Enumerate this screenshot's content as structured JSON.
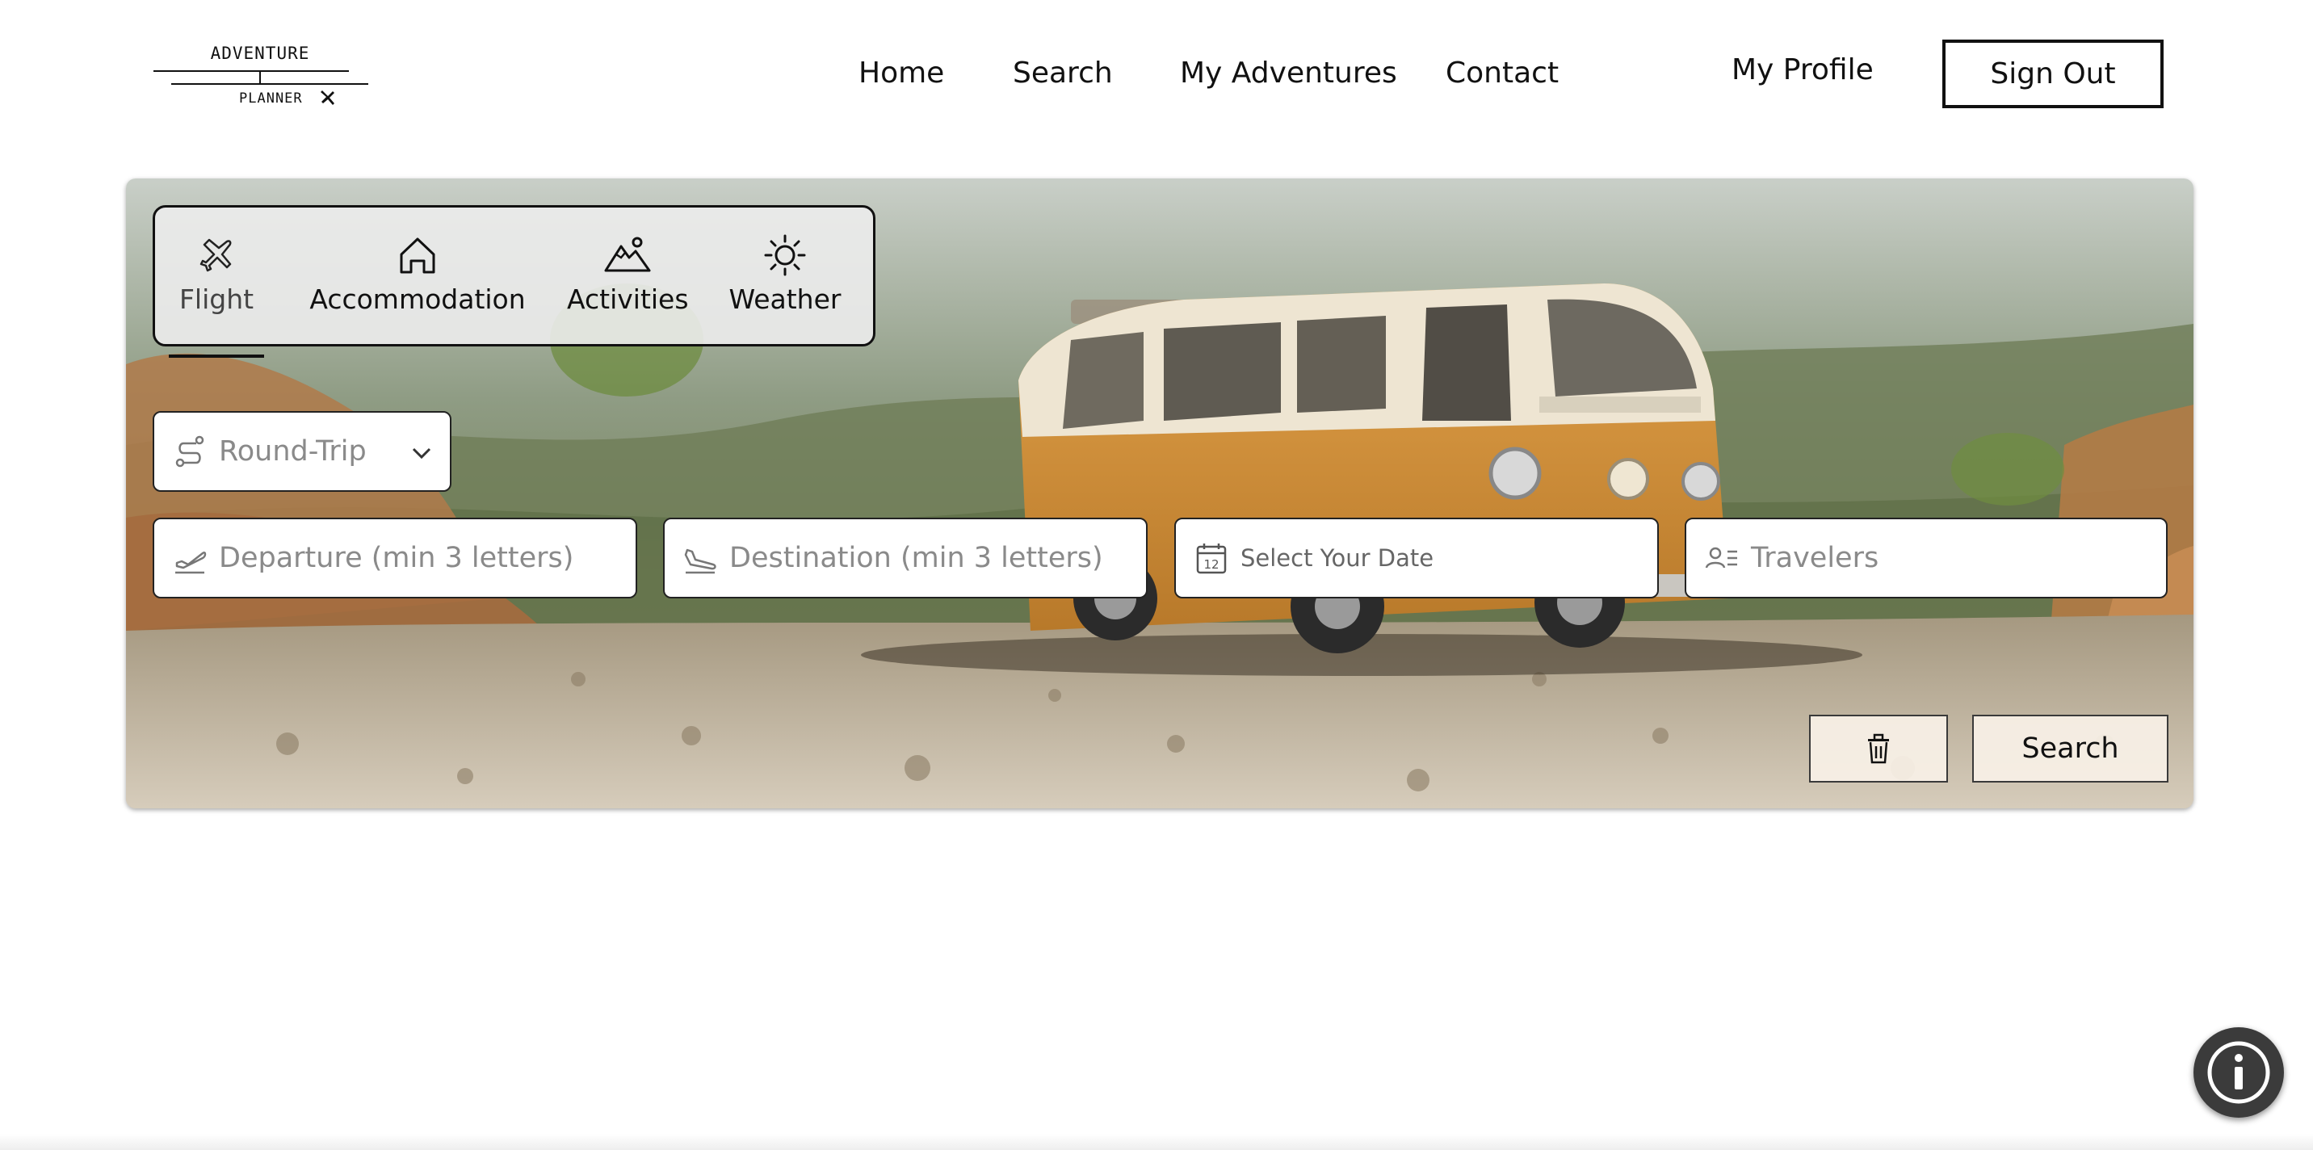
{
  "header": {
    "logo": {
      "line1": "ADVENTURE",
      "line2": "PLANNER",
      "icon": "airplane-icon"
    },
    "nav": [
      {
        "label": "Home"
      },
      {
        "label": "Search"
      },
      {
        "label": "My Adventures"
      },
      {
        "label": "Contact"
      }
    ],
    "profile_label": "My Profile",
    "signout_label": "Sign Out"
  },
  "search_panel": {
    "background_image": "orange camper van on rocky gravel trail with forested hills",
    "tabs": [
      {
        "label": "Flight",
        "icon": "airplane-icon",
        "active": true
      },
      {
        "label": "Accommodation",
        "icon": "house-icon",
        "active": false
      },
      {
        "label": "Activities",
        "icon": "mountain-icon",
        "active": false
      },
      {
        "label": "Weather",
        "icon": "sun-icon",
        "active": false
      }
    ],
    "trip_type": {
      "value": "Round-Trip",
      "icon": "route-icon"
    },
    "departure": {
      "placeholder": "Departure (min 3 letters)",
      "icon": "takeoff-icon"
    },
    "destination": {
      "placeholder": "Destination (min 3 letters)",
      "icon": "landing-icon"
    },
    "date": {
      "placeholder": "Select Your Date",
      "icon": "calendar-icon",
      "calendar_day": "12"
    },
    "travelers": {
      "placeholder": "Travelers",
      "icon": "travelers-icon"
    },
    "clear_button": {
      "icon": "trash-icon"
    },
    "search_button": {
      "label": "Search"
    }
  },
  "info_button": {
    "icon": "info-icon"
  },
  "colors": {
    "van_orange": "#d9912f",
    "border_dark": "#111111",
    "placeholder_gray": "#8a8a8a"
  }
}
